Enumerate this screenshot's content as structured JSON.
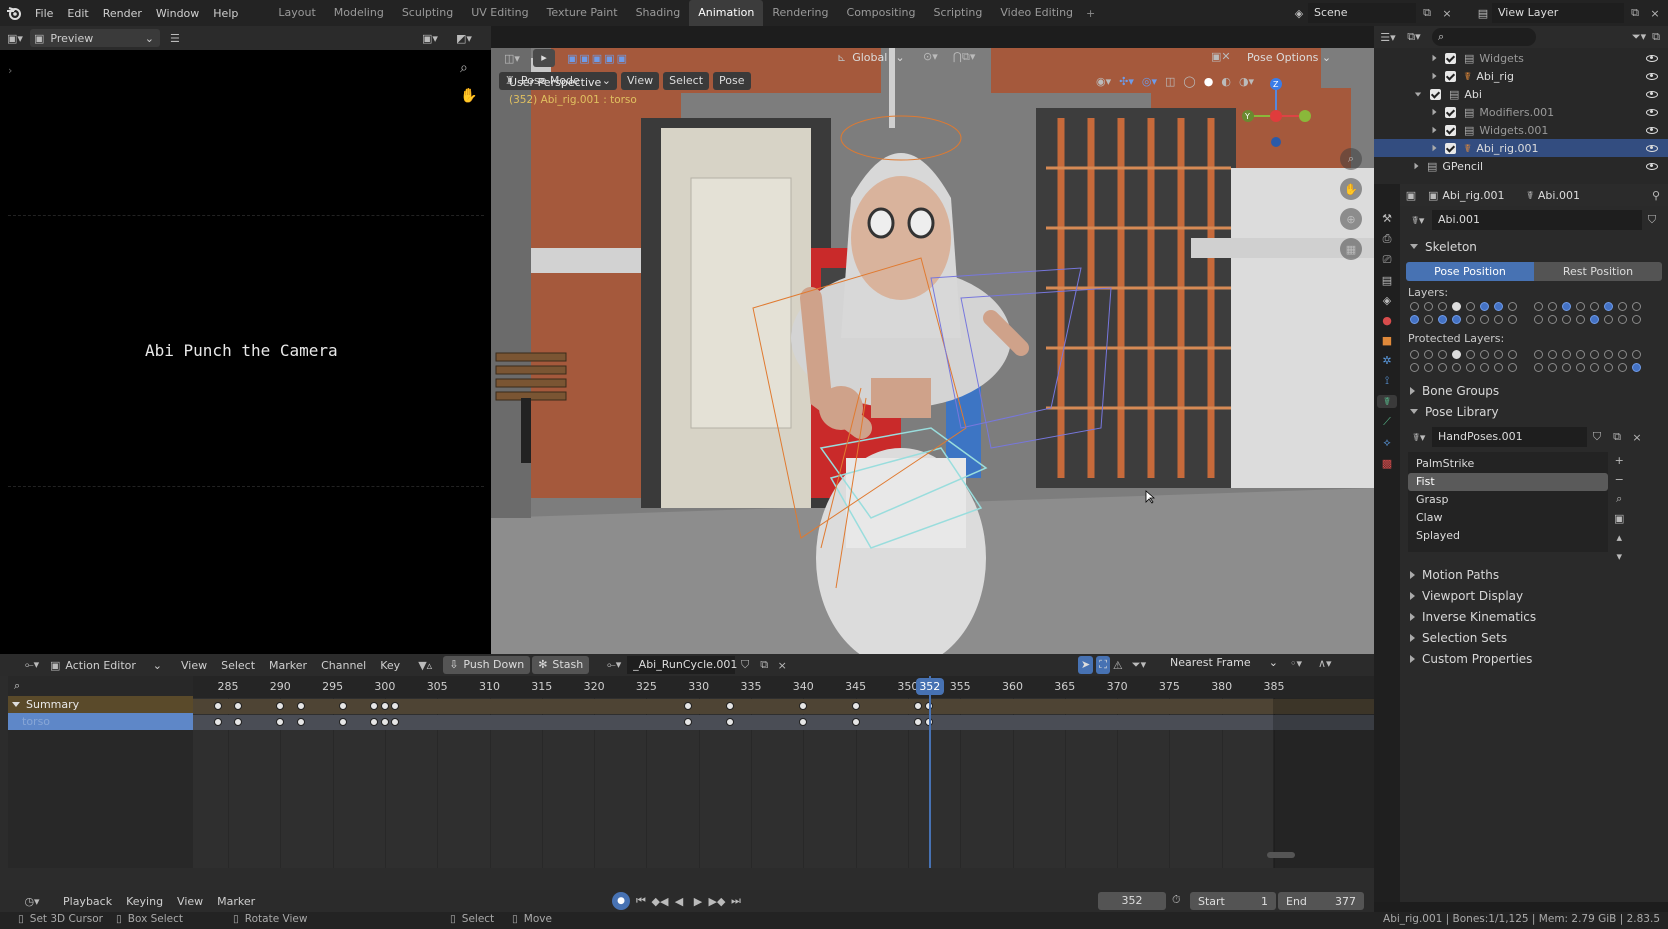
{
  "topbar": {
    "menus": [
      "File",
      "Edit",
      "Render",
      "Window",
      "Help"
    ],
    "workspaces": [
      "Layout",
      "Modeling",
      "Sculpting",
      "UV Editing",
      "Texture Paint",
      "Shading",
      "Animation",
      "Rendering",
      "Compositing",
      "Scripting",
      "Video Editing"
    ],
    "active_workspace": "Animation",
    "add_tab": "+",
    "scene": "Scene",
    "view_layer": "View Layer"
  },
  "preview": {
    "mode": "Preview",
    "text": "Abi Punch the Camera"
  },
  "viewport": {
    "mode": "Pose Mode",
    "menus": [
      "View",
      "Select",
      "Pose"
    ],
    "orientation": "Global",
    "pose_options": "Pose Options",
    "perspective": "User Perspective",
    "info": "(352) Abi_rig.001 : torso"
  },
  "outliner": {
    "items": [
      {
        "name": "Widgets",
        "level": 2
      },
      {
        "name": "Abi_rig",
        "level": 2
      },
      {
        "name": "Abi",
        "level": 1
      },
      {
        "name": "Modifiers.001",
        "level": 2
      },
      {
        "name": "Widgets.001",
        "level": 2
      },
      {
        "name": "Abi_rig.001",
        "level": 2,
        "selected": true
      },
      {
        "name": "GPencil",
        "level": 1
      }
    ]
  },
  "properties": {
    "object": "Abi_rig.001",
    "armature": "Abi.001",
    "data_name": "Abi.001",
    "skeleton": "Skeleton",
    "pose_position": "Pose Position",
    "rest_position": "Rest Position",
    "layers_label": "Layers:",
    "protected_label": "Protected Layers:",
    "bone_groups": "Bone Groups",
    "pose_library": "Pose Library",
    "pose_lib_name": "HandPoses.001",
    "poses": [
      "PalmStrike",
      "Fist",
      "Grasp",
      "Claw",
      "Splayed"
    ],
    "selected_pose": "Fist",
    "sections": [
      "Motion Paths",
      "Viewport Display",
      "Inverse Kinematics",
      "Selection Sets",
      "Custom Properties"
    ]
  },
  "action_editor": {
    "mode": "Action Editor",
    "menus": [
      "View",
      "Select",
      "Marker",
      "Channel",
      "Key"
    ],
    "push_down": "Push Down",
    "stash": "Stash",
    "action": "_Abi_RunCycle.001",
    "snap": "Nearest Frame",
    "channels": [
      "Summary",
      "torso"
    ],
    "frame_ticks": [
      285,
      290,
      295,
      300,
      305,
      310,
      315,
      320,
      325,
      330,
      335,
      340,
      345,
      350,
      355,
      360,
      365,
      370,
      375,
      380,
      385
    ],
    "current_frame": 352,
    "keyframes": [
      284,
      286,
      290,
      292,
      296,
      299,
      300,
      301,
      329,
      333,
      340,
      345,
      351,
      352
    ]
  },
  "timeline": {
    "menus": [
      "Playback",
      "Keying",
      "View",
      "Marker"
    ],
    "frame": "352",
    "start_label": "Start",
    "start": "1",
    "end_label": "End",
    "end": "377"
  },
  "statusbar": {
    "items": [
      "Set 3D Cursor",
      "Box Select",
      "Rotate View",
      "Select",
      "Move"
    ],
    "info": "Abi_rig.001 | Bones:1/1,125 | Mem: 2.79 GiB | 2.83.5"
  },
  "colors": {
    "accent": "#4772b3",
    "selected_row": "#334d80",
    "wall": "#a8593a",
    "current_frame": "#4772b3",
    "summary_row": "#5a4a2a"
  }
}
